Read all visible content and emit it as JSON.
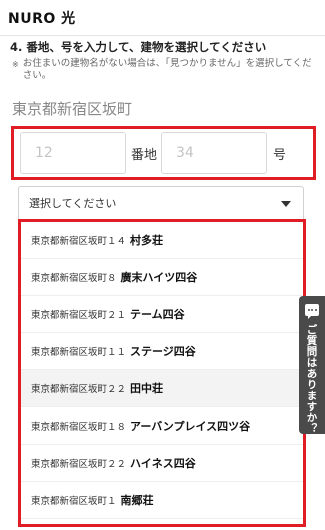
{
  "header": {
    "logo": "NURO 光"
  },
  "step": {
    "title": "4. 番地、号を入力して、建物を選択してください",
    "note_mark": "※",
    "note": "お住まいの建物名がない場合は、「見つかりません」を選択してください。"
  },
  "address": "東京都新宿区坂町",
  "numbers": {
    "banchi_placeholder": "12",
    "banchi_unit": "番地",
    "go_placeholder": "34",
    "go_unit": "号"
  },
  "select": {
    "placeholder": "選択してください"
  },
  "buildings": [
    {
      "addr": "東京都新宿区坂町１４",
      "name": "村多荘"
    },
    {
      "addr": "東京都新宿区坂町８",
      "name": "廣末ハイツ四谷"
    },
    {
      "addr": "東京都新宿区坂町２１",
      "name": "テーム四谷"
    },
    {
      "addr": "東京都新宿区坂町１１",
      "name": "ステージ四谷"
    },
    {
      "addr": "東京都新宿区坂町２２",
      "name": "田中荘"
    },
    {
      "addr": "東京都新宿区坂町１８",
      "name": "アーバンプレイス四ツ谷"
    },
    {
      "addr": "東京都新宿区坂町２２",
      "name": "ハイネス四谷"
    },
    {
      "addr": "東京都新宿区坂町１",
      "name": "南郷荘"
    }
  ],
  "faq": {
    "label": "ご質問はありますか？",
    "icon": "chat-bubble-icon"
  },
  "colors": {
    "highlight": "#e01c24",
    "tab_bg": "#4a4a4a"
  }
}
